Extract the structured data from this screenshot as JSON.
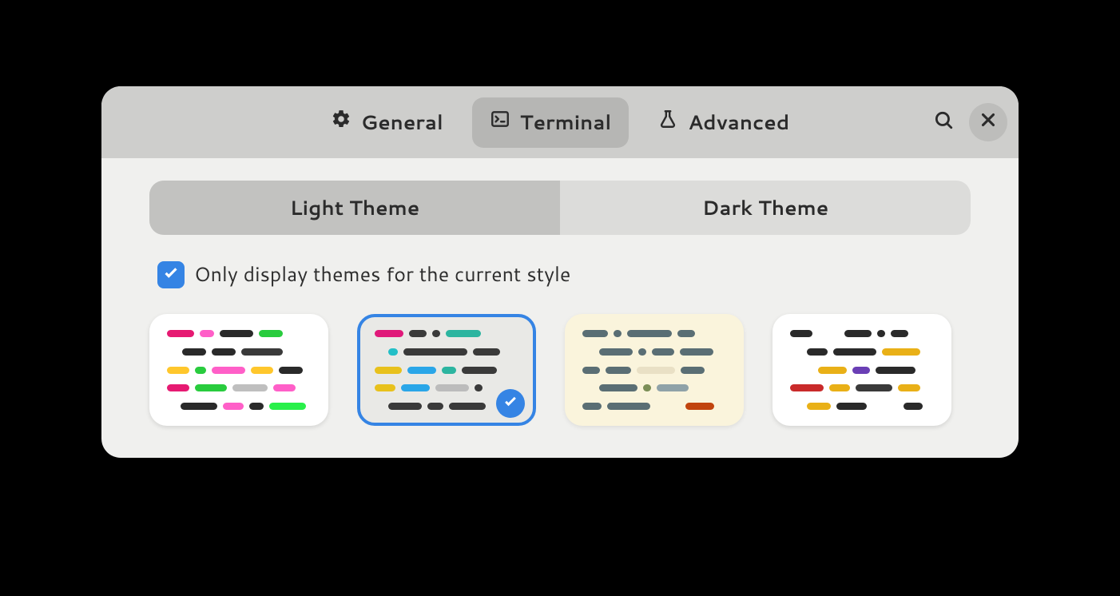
{
  "header": {
    "tabs": [
      {
        "label": "General",
        "icon": "gear-icon",
        "active": false
      },
      {
        "label": "Terminal",
        "icon": "terminal-icon",
        "active": true
      },
      {
        "label": "Advanced",
        "icon": "flask-icon",
        "active": false
      }
    ]
  },
  "segments": {
    "light": "Light Theme",
    "dark": "Dark Theme",
    "active": "light"
  },
  "filter": {
    "label": "Only display themes for the current style",
    "checked": true
  },
  "themes": [
    {
      "id": "bright",
      "background": "white",
      "selected": false
    },
    {
      "id": "default-light",
      "background": "gray",
      "selected": true
    },
    {
      "id": "solarized",
      "background": "cream",
      "selected": false
    },
    {
      "id": "palette",
      "background": "white",
      "selected": false
    }
  ],
  "colors": {
    "accent": "#3584e4"
  }
}
